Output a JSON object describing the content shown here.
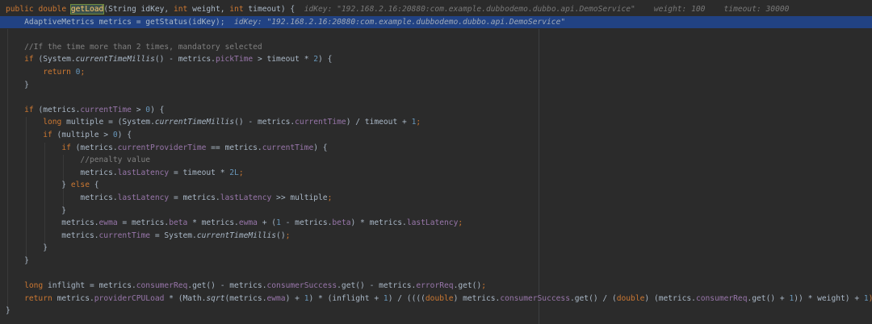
{
  "code": {
    "lines": [
      {
        "tokens": [
          {
            "t": "public ",
            "c": "kw"
          },
          {
            "t": "double ",
            "c": "kw"
          },
          {
            "t": "getLoad",
            "c": "fn-hl"
          },
          {
            "t": "(String idKey, ",
            "c": "id"
          },
          {
            "t": "int ",
            "c": "kw"
          },
          {
            "t": "weight, ",
            "c": "id"
          },
          {
            "t": "int ",
            "c": "kw"
          },
          {
            "t": "timeout) {  ",
            "c": "id"
          },
          {
            "t": "idKey: \"192.168.2.16:20880:com.example.dubbodemo.dubbo.api.DemoService\"    weight: 100    timeout: 30000",
            "c": "hint"
          }
        ]
      },
      {
        "hl": true,
        "tokens": [
          {
            "t": "    AdaptiveMetrics metrics = getStatus(idKey);  ",
            "c": "id"
          },
          {
            "t": "idKey: \"192.168.2.16:20880:com.example.dubbodemo.dubbo.api.DemoService\"",
            "c": "hint-hl"
          }
        ]
      },
      {
        "tokens": []
      },
      {
        "tokens": [
          {
            "t": "    //If the time more than 2 times, mandatory selected",
            "c": "cmt"
          }
        ]
      },
      {
        "tokens": [
          {
            "t": "    ",
            "c": "id"
          },
          {
            "t": "if ",
            "c": "kw"
          },
          {
            "t": "(System.",
            "c": "id"
          },
          {
            "t": "currentTimeMillis",
            "c": "sm"
          },
          {
            "t": "() - metrics.",
            "c": "id"
          },
          {
            "t": "pickTime",
            "c": "fld"
          },
          {
            "t": " > timeout * ",
            "c": "id"
          },
          {
            "t": "2",
            "c": "num"
          },
          {
            "t": ") {",
            "c": "id"
          }
        ]
      },
      {
        "tokens": [
          {
            "t": "        ",
            "c": "id"
          },
          {
            "t": "return ",
            "c": "kw"
          },
          {
            "t": "0",
            "c": "num"
          },
          {
            "t": ";",
            "c": "semi"
          }
        ]
      },
      {
        "tokens": [
          {
            "t": "    }",
            "c": "id"
          }
        ]
      },
      {
        "tokens": []
      },
      {
        "tokens": [
          {
            "t": "    ",
            "c": "id"
          },
          {
            "t": "if ",
            "c": "kw"
          },
          {
            "t": "(metrics.",
            "c": "id"
          },
          {
            "t": "currentTime",
            "c": "fld"
          },
          {
            "t": " > ",
            "c": "id"
          },
          {
            "t": "0",
            "c": "num"
          },
          {
            "t": ") {",
            "c": "id"
          }
        ]
      },
      {
        "tokens": [
          {
            "t": "        ",
            "c": "id"
          },
          {
            "t": "long ",
            "c": "kw"
          },
          {
            "t": "multiple = (System.",
            "c": "id"
          },
          {
            "t": "currentTimeMillis",
            "c": "sm"
          },
          {
            "t": "() - metrics.",
            "c": "id"
          },
          {
            "t": "currentTime",
            "c": "fld"
          },
          {
            "t": ") / timeout + ",
            "c": "id"
          },
          {
            "t": "1",
            "c": "num"
          },
          {
            "t": ";",
            "c": "semi"
          }
        ]
      },
      {
        "tokens": [
          {
            "t": "        ",
            "c": "id"
          },
          {
            "t": "if ",
            "c": "kw"
          },
          {
            "t": "(multiple > ",
            "c": "id"
          },
          {
            "t": "0",
            "c": "num"
          },
          {
            "t": ") {",
            "c": "id"
          }
        ]
      },
      {
        "tokens": [
          {
            "t": "            ",
            "c": "id"
          },
          {
            "t": "if ",
            "c": "kw"
          },
          {
            "t": "(metrics.",
            "c": "id"
          },
          {
            "t": "currentProviderTime",
            "c": "fld"
          },
          {
            "t": " == metrics.",
            "c": "id"
          },
          {
            "t": "currentTime",
            "c": "fld"
          },
          {
            "t": ") {",
            "c": "id"
          }
        ]
      },
      {
        "tokens": [
          {
            "t": "                //penalty value",
            "c": "cmt"
          }
        ]
      },
      {
        "tokens": [
          {
            "t": "                metrics.",
            "c": "id"
          },
          {
            "t": "lastLatency",
            "c": "fld"
          },
          {
            "t": " = timeout * ",
            "c": "id"
          },
          {
            "t": "2L",
            "c": "num"
          },
          {
            "t": ";",
            "c": "semi"
          }
        ]
      },
      {
        "tokens": [
          {
            "t": "            } ",
            "c": "id"
          },
          {
            "t": "else ",
            "c": "kw"
          },
          {
            "t": "{",
            "c": "id"
          }
        ]
      },
      {
        "tokens": [
          {
            "t": "                metrics.",
            "c": "id"
          },
          {
            "t": "lastLatency",
            "c": "fld"
          },
          {
            "t": " = metrics.",
            "c": "id"
          },
          {
            "t": "lastLatency",
            "c": "fld"
          },
          {
            "t": " >> multiple",
            "c": "id"
          },
          {
            "t": ";",
            "c": "semi"
          }
        ]
      },
      {
        "tokens": [
          {
            "t": "            }",
            "c": "id"
          }
        ]
      },
      {
        "tokens": [
          {
            "t": "            metrics.",
            "c": "id"
          },
          {
            "t": "ewma",
            "c": "fld"
          },
          {
            "t": " = metrics.",
            "c": "id"
          },
          {
            "t": "beta",
            "c": "fld"
          },
          {
            "t": " * metrics.",
            "c": "id"
          },
          {
            "t": "ewma",
            "c": "fld"
          },
          {
            "t": " + (",
            "c": "id"
          },
          {
            "t": "1",
            "c": "num"
          },
          {
            "t": " - metrics.",
            "c": "id"
          },
          {
            "t": "beta",
            "c": "fld"
          },
          {
            "t": ") * metrics.",
            "c": "id"
          },
          {
            "t": "lastLatency",
            "c": "fld"
          },
          {
            "t": ";",
            "c": "semi"
          }
        ]
      },
      {
        "tokens": [
          {
            "t": "            metrics.",
            "c": "id"
          },
          {
            "t": "currentTime",
            "c": "fld"
          },
          {
            "t": " = System.",
            "c": "id"
          },
          {
            "t": "currentTimeMillis",
            "c": "sm"
          },
          {
            "t": "()",
            "c": "id"
          },
          {
            "t": ";",
            "c": "semi"
          }
        ]
      },
      {
        "tokens": [
          {
            "t": "        }",
            "c": "id"
          }
        ]
      },
      {
        "tokens": [
          {
            "t": "    }",
            "c": "id"
          }
        ]
      },
      {
        "tokens": []
      },
      {
        "tokens": [
          {
            "t": "    ",
            "c": "id"
          },
          {
            "t": "long ",
            "c": "kw"
          },
          {
            "t": "inflight = metrics.",
            "c": "id"
          },
          {
            "t": "consumerReq",
            "c": "fld"
          },
          {
            "t": ".get() - metrics.",
            "c": "id"
          },
          {
            "t": "consumerSuccess",
            "c": "fld"
          },
          {
            "t": ".get() - metrics.",
            "c": "id"
          },
          {
            "t": "errorReq",
            "c": "fld"
          },
          {
            "t": ".get()",
            "c": "id"
          },
          {
            "t": ";",
            "c": "semi"
          }
        ]
      },
      {
        "tokens": [
          {
            "t": "    ",
            "c": "id"
          },
          {
            "t": "return ",
            "c": "kw"
          },
          {
            "t": "metrics.",
            "c": "id"
          },
          {
            "t": "providerCPULoad",
            "c": "fld"
          },
          {
            "t": " * (Math.",
            "c": "id"
          },
          {
            "t": "sqrt",
            "c": "sm"
          },
          {
            "t": "(metrics.",
            "c": "id"
          },
          {
            "t": "ewma",
            "c": "fld"
          },
          {
            "t": ") + ",
            "c": "id"
          },
          {
            "t": "1",
            "c": "num"
          },
          {
            "t": ") * (inflight + ",
            "c": "id"
          },
          {
            "t": "1",
            "c": "num"
          },
          {
            "t": ") / ((((",
            "c": "id"
          },
          {
            "t": "double",
            "c": "kw"
          },
          {
            "t": ") metrics.",
            "c": "id"
          },
          {
            "t": "consumerSuccess",
            "c": "fld"
          },
          {
            "t": ".get() / (",
            "c": "id"
          },
          {
            "t": "double",
            "c": "kw"
          },
          {
            "t": ") (metrics.",
            "c": "id"
          },
          {
            "t": "consumerReq",
            "c": "fld"
          },
          {
            "t": ".get() + ",
            "c": "id"
          },
          {
            "t": "1",
            "c": "num"
          },
          {
            "t": ")) * weight) + ",
            "c": "id"
          },
          {
            "t": "1",
            "c": "num"
          },
          {
            "t": ");",
            "c": "semi"
          }
        ]
      },
      {
        "tokens": [
          {
            "t": "}",
            "c": "id"
          }
        ]
      }
    ]
  }
}
